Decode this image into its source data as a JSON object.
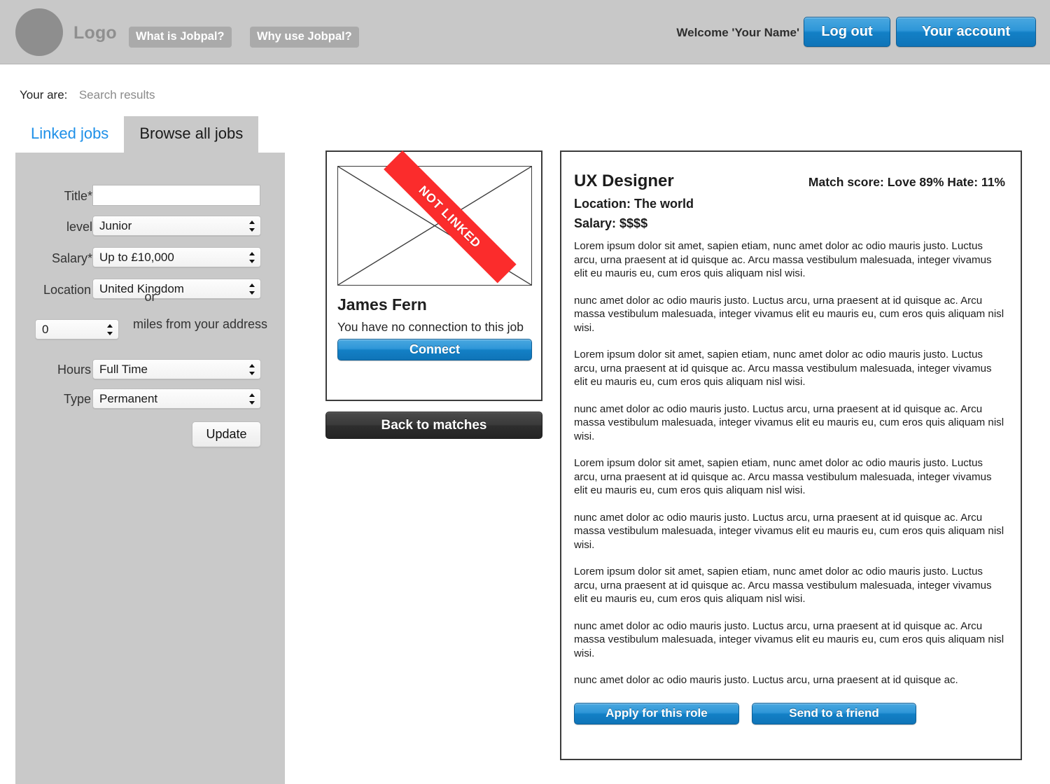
{
  "header": {
    "logo_text": "Logo",
    "nav": [
      {
        "label": "What is Jobpal?"
      },
      {
        "label": "Why use Jobpal?"
      }
    ],
    "welcome": "Welcome 'Your Name'",
    "logout_label": "Log out",
    "account_label": "Your account",
    "bar_color": "#c8c8c8",
    "accent_color": "#1380c6"
  },
  "breadcrumb": {
    "label": "Your are:",
    "value": "Search results"
  },
  "tabs": [
    {
      "label": "Linked jobs",
      "active": false
    },
    {
      "label": "Browse all jobs",
      "active": true
    }
  ],
  "search_form": {
    "title": {
      "label": "Title*",
      "value": "",
      "placeholder": ""
    },
    "level": {
      "label": "level",
      "value": "Junior"
    },
    "salary": {
      "label": "Salary*",
      "value": "Up to £10,000"
    },
    "location": {
      "label": "Location",
      "value": "United Kingdom"
    },
    "or_text": "or",
    "miles": {
      "value": "0",
      "suffix_label": "miles from your address"
    },
    "hours": {
      "label": "Hours",
      "value": "Full Time"
    },
    "type": {
      "label": "Type",
      "value": "Permanent"
    },
    "update_label": "Update"
  },
  "match_card": {
    "ribbon_label": "NOT LINKED",
    "ribbon_color": "#fb2c2c",
    "person_name": "James Fern",
    "connection_status": "You have no connection to this job",
    "connect_label": "Connect",
    "back_label": "Back to matches"
  },
  "job_detail": {
    "title": "UX Designer",
    "match_score": "Match score: Love 89% Hate: 11%",
    "location": "Location: The world",
    "salary": "Salary: $$$$",
    "paragraphs": [
      "Lorem ipsum dolor sit amet, sapien etiam, nunc amet dolor ac odio mauris justo. Luctus arcu, urna praesent at id quisque ac. Arcu massa vestibulum malesuada, integer vivamus elit eu mauris eu, cum eros quis aliquam nisl wisi.",
      "nunc amet dolor ac odio mauris justo. Luctus arcu, urna praesent at id quisque ac. Arcu massa vestibulum malesuada, integer vivamus elit eu mauris eu, cum eros quis aliquam nisl wisi.",
      "Lorem ipsum dolor sit amet, sapien etiam, nunc amet dolor ac odio mauris justo. Luctus arcu, urna praesent at id quisque ac. Arcu massa vestibulum malesuada, integer vivamus elit eu mauris eu, cum eros quis aliquam nisl wisi.",
      "nunc amet dolor ac odio mauris justo. Luctus arcu, urna praesent at id quisque ac. Arcu massa vestibulum malesuada, integer vivamus elit eu mauris eu, cum eros quis aliquam nisl wisi.",
      "Lorem ipsum dolor sit amet, sapien etiam, nunc amet dolor ac odio mauris justo. Luctus arcu, urna praesent at id quisque ac. Arcu massa vestibulum malesuada, integer vivamus elit eu mauris eu, cum eros quis aliquam nisl wisi.",
      "nunc amet dolor ac odio mauris justo. Luctus arcu, urna praesent at id quisque ac. Arcu massa vestibulum malesuada, integer vivamus elit eu mauris eu, cum eros quis aliquam nisl wisi.",
      "Lorem ipsum dolor sit amet, sapien etiam, nunc amet dolor ac odio mauris justo. Luctus arcu, urna praesent at id quisque ac. Arcu massa vestibulum malesuada, integer vivamus elit eu mauris eu, cum eros quis aliquam nisl wisi.",
      "nunc amet dolor ac odio mauris justo. Luctus arcu, urna praesent at id quisque ac. Arcu massa vestibulum malesuada, integer vivamus elit eu mauris eu, cum eros quis aliquam nisl wisi.",
      "nunc amet dolor ac odio mauris justo. Luctus arcu, urna praesent at id quisque ac."
    ],
    "apply_label": "Apply for this role",
    "send_label": "Send to a friend"
  }
}
